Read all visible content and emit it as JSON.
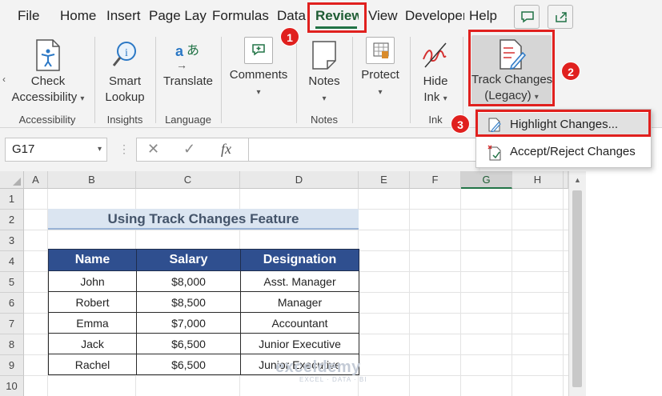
{
  "tabs": {
    "items": [
      "File",
      "Home",
      "Insert",
      "Page Layout",
      "Formulas",
      "Data",
      "Review",
      "View",
      "Developer",
      "Help"
    ],
    "active": "Review"
  },
  "ribbon": {
    "accessibility": {
      "btn": "Check\nAccessibility",
      "group": "Accessibility"
    },
    "insights": {
      "btn": "Smart\nLookup",
      "group": "Insights"
    },
    "language": {
      "btn": "Translate",
      "group": "Language"
    },
    "comments": {
      "btn": "Comments"
    },
    "notes": {
      "btn": "Notes",
      "group": "Notes"
    },
    "protect": {
      "btn": "Protect"
    },
    "ink": {
      "btn": "Hide\nInk",
      "group": "Ink"
    },
    "track_changes": {
      "btn": "Track Changes\n(Legacy)"
    }
  },
  "formula_bar": {
    "name_box": "G17",
    "cancel_icon": "✕",
    "enter_icon": "✓",
    "fx_label": "fx",
    "formula": ""
  },
  "menu": {
    "items": [
      "Highlight Changes...",
      "Accept/Reject Changes"
    ],
    "highlighted_index": 0
  },
  "grid": {
    "columns": [
      "A",
      "B",
      "C",
      "D",
      "E",
      "F",
      "G",
      "H"
    ],
    "selected_column": "G",
    "rows": [
      "1",
      "2",
      "3",
      "4",
      "5",
      "6",
      "7",
      "8",
      "9",
      "10"
    ]
  },
  "sheet": {
    "title": "Using Track Changes Feature",
    "table": {
      "headers": [
        "Name",
        "Salary",
        "Designation"
      ],
      "rows": [
        [
          "John",
          "$8,000",
          "Asst. Manager"
        ],
        [
          "Robert",
          "$8,500",
          "Manager"
        ],
        [
          "Emma",
          "$7,000",
          "Accountant"
        ],
        [
          "Jack",
          "$6,500",
          "Junior Executive"
        ],
        [
          "Rachel",
          "$6,500",
          "Junior Executive"
        ]
      ]
    }
  },
  "callouts": [
    "1",
    "2",
    "3"
  ],
  "watermark": {
    "brand": "exceldemy",
    "tagline": "EXCEL · DATA · BI"
  },
  "colors": {
    "accent": "#217346",
    "callout": "#e0201e",
    "table_header": "#2f4f8f",
    "title_fill": "#dbe5f1"
  }
}
